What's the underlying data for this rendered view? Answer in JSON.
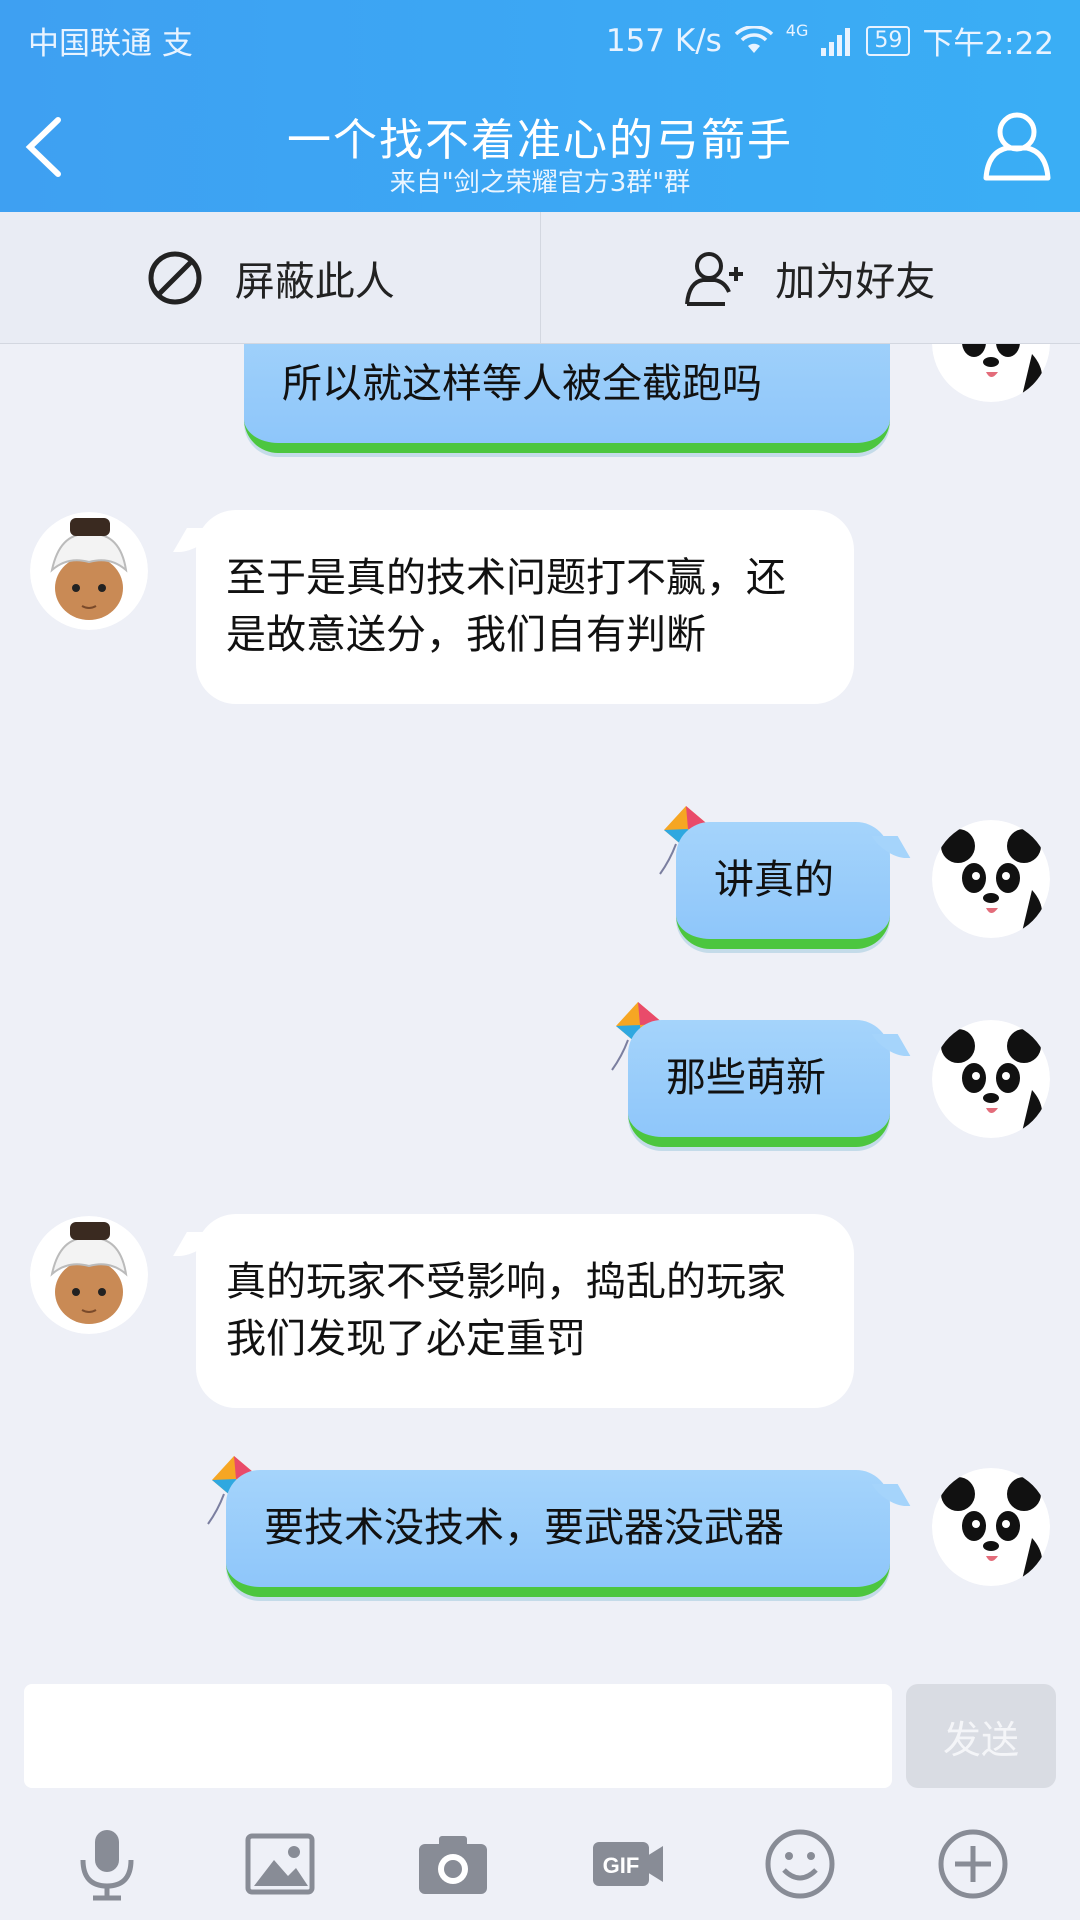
{
  "status_bar": {
    "carrier": "中国联通 支",
    "speed": "157 K/s",
    "network": "4G",
    "battery": "59",
    "time": "下午2:22"
  },
  "header": {
    "title": "一个找不着准心的弓箭手",
    "subtitle": "来自\"剑之荣耀官方3群\"群"
  },
  "actions": {
    "block_label": "屏蔽此人",
    "add_friend_label": "加为好友"
  },
  "messages": [
    {
      "side": "out",
      "text": "所以就这样等人被全截跑吗"
    },
    {
      "side": "in",
      "text": "至于是真的技术问题打不赢，还是故意送分，我们自有判断"
    },
    {
      "side": "out",
      "text": "讲真的"
    },
    {
      "side": "out",
      "text": "那些萌新"
    },
    {
      "side": "in",
      "text": "真的玩家不受影响，捣乱的玩家我们发现了必定重罚"
    },
    {
      "side": "out",
      "text": "要技术没技术，要武器没武器"
    }
  ],
  "input": {
    "value": "",
    "send_label": "发送"
  },
  "toolbar": [
    "mic-icon",
    "image-icon",
    "camera-icon",
    "gif-icon",
    "emoji-icon",
    "plus-icon"
  ],
  "colors": {
    "header": "#3ea0f2",
    "bubble_out": "#a5d4fb",
    "bubble_in": "#ffffff",
    "grass": "#4cc63f"
  }
}
